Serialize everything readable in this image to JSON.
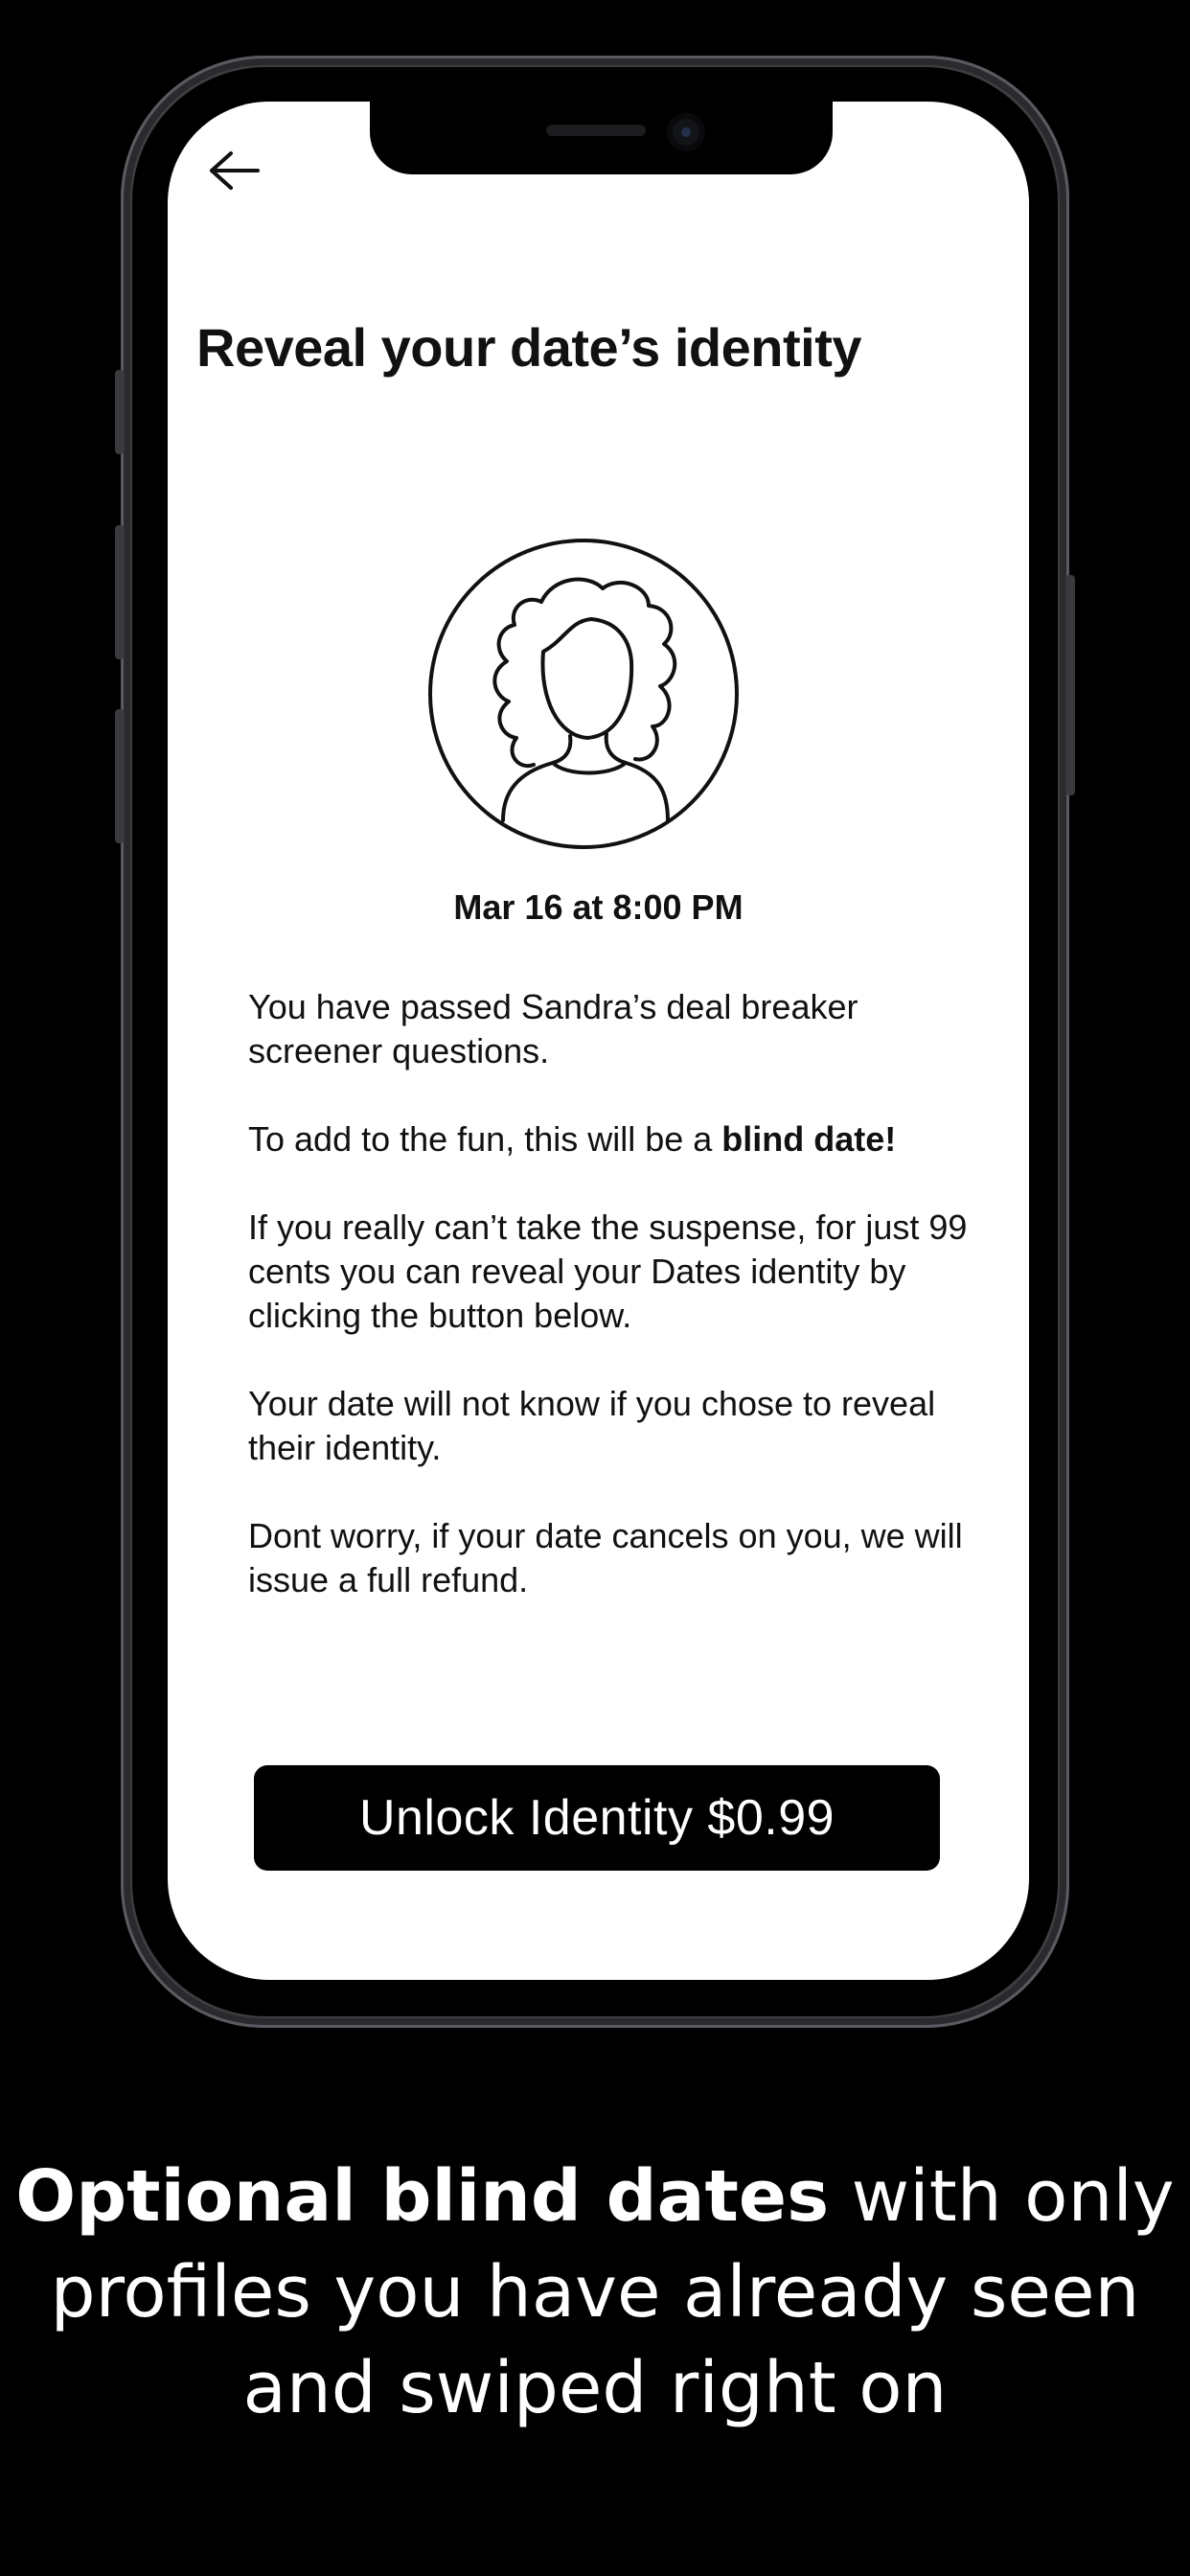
{
  "screen": {
    "back_icon": "back-arrow-icon",
    "title": "Reveal your date’s identity",
    "avatar_icon": "person-avatar-icon",
    "date_time": "Mar 16 at 8:00 PM",
    "paragraphs": {
      "p1": "You have passed Sandra’s deal breaker screener questions.",
      "p2_prefix": "To add to the fun, this will be a ",
      "p2_bold": "blind date!",
      "p3": "If you really can’t take the suspense, for just 99 cents you can reveal your Dates identity by clicking the button below.",
      "p4": "Your date will not know if you chose to reveal their identity.",
      "p5": "Dont worry, if your date cancels on you, we will issue a full refund."
    },
    "unlock_button_label": "Unlock Identity $0.99"
  },
  "caption": {
    "bold": "Optional blind dates",
    "rest": " with only profiles you have already seen and swiped right on"
  },
  "colors": {
    "background": "#000000",
    "screen": "#ffffff",
    "button": "#000000",
    "button_text": "#ffffff"
  }
}
